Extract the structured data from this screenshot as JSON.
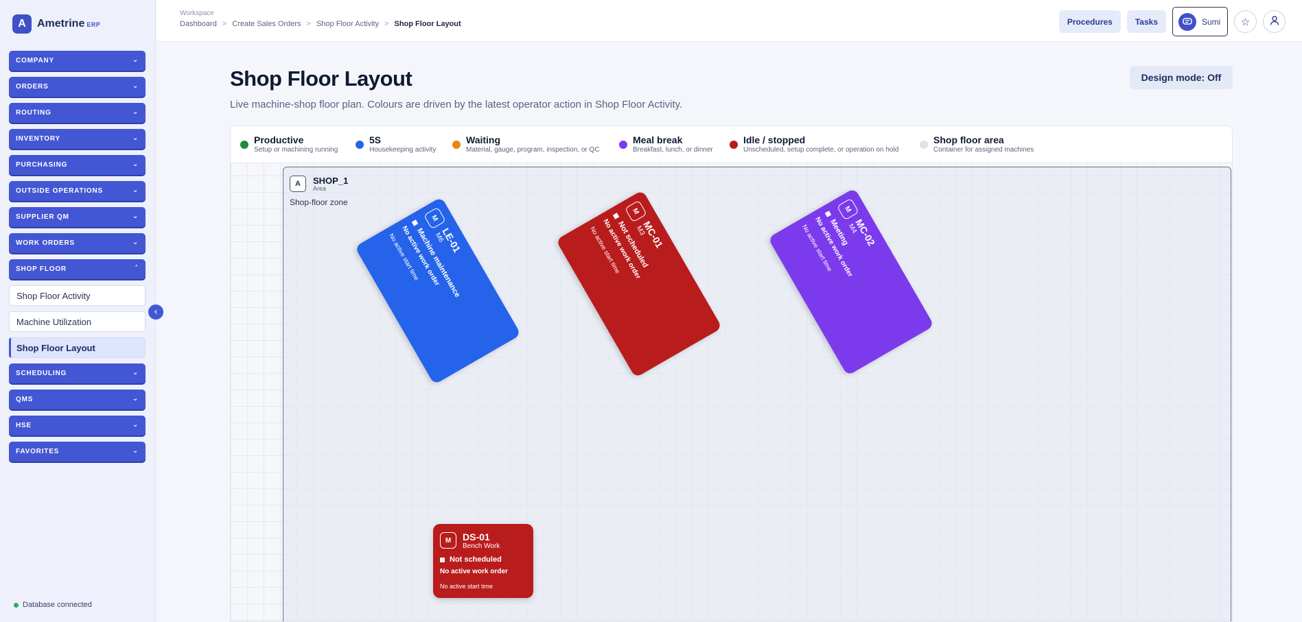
{
  "brand": {
    "logo_letter": "A",
    "name": "Ametrine",
    "suffix": "ERP"
  },
  "sidebar": {
    "groups_top": [
      "COMPANY",
      "ORDERS",
      "ROUTING",
      "INVENTORY",
      "PURCHASING",
      "OUTSIDE OPERATIONS",
      "SUPPLIER QM",
      "WORK ORDERS"
    ],
    "shop_floor": {
      "label": "SHOP FLOOR",
      "items": [
        "Shop Floor Activity",
        "Machine Utilization",
        "Shop Floor Layout"
      ],
      "active": "Shop Floor Layout"
    },
    "groups_bottom": [
      "SCHEDULING",
      "QMS",
      "HSE",
      "FAVORITES"
    ],
    "status": "Database connected"
  },
  "topbar": {
    "workspace": "Workspace",
    "breadcrumbs": [
      "Dashboard",
      "Create Sales Orders",
      "Shop Floor Activity",
      "Shop Floor Layout"
    ],
    "separator": ">",
    "procedures": "Procedures",
    "tasks": "Tasks",
    "assistant": "Sumi"
  },
  "page": {
    "title": "Shop Floor Layout",
    "subtitle": "Live machine-shop floor plan. Colours are driven by the latest operator action in Shop Floor Activity.",
    "design_mode": "Design mode: Off"
  },
  "legend": [
    {
      "name": "Productive",
      "desc": "Setup or machining running",
      "color": "#1f8a3c"
    },
    {
      "name": "5S",
      "desc": "Housekeeping activity",
      "color": "#2563eb"
    },
    {
      "name": "Waiting",
      "desc": "Material, gauge, program, inspection, or QC",
      "color": "#e8870e"
    },
    {
      "name": "Meal break",
      "desc": "Breakfast, lunch, or dinner",
      "color": "#7c3aed"
    },
    {
      "name": "Idle / stopped",
      "desc": "Unscheduled, setup complete, or operation on hold",
      "color": "#b91c1c"
    },
    {
      "name": "Shop floor area",
      "desc": "Container for assigned machines",
      "color": "#dde2ec"
    }
  ],
  "area": {
    "badge": "A",
    "name": "SHOP_1",
    "type": "Area",
    "zone": "Shop-floor zone"
  },
  "machines": [
    {
      "badge": "M",
      "code": "LE-01",
      "type": "M6",
      "status": "Machine maintenance",
      "work_order": "No active work order",
      "start": "No active start time",
      "color": "#2563eb",
      "rotation_deg": 60
    },
    {
      "badge": "M",
      "code": "MC-01",
      "type": "M3",
      "status": "Not scheduled",
      "work_order": "No active work order",
      "start": "No active start time",
      "color": "#b91c1c",
      "rotation_deg": 60
    },
    {
      "badge": "M",
      "code": "MC-02",
      "type": "M4",
      "status": "Meeting",
      "work_order": "No active work order",
      "start": "No active start time",
      "color": "#7c3aed",
      "rotation_deg": 60
    },
    {
      "badge": "M",
      "code": "DS-01",
      "type": "Bench Work",
      "status": "Not scheduled",
      "work_order": "No active work order",
      "start": "No active start time",
      "color": "#b91c1c",
      "rotation_deg": 0
    }
  ]
}
